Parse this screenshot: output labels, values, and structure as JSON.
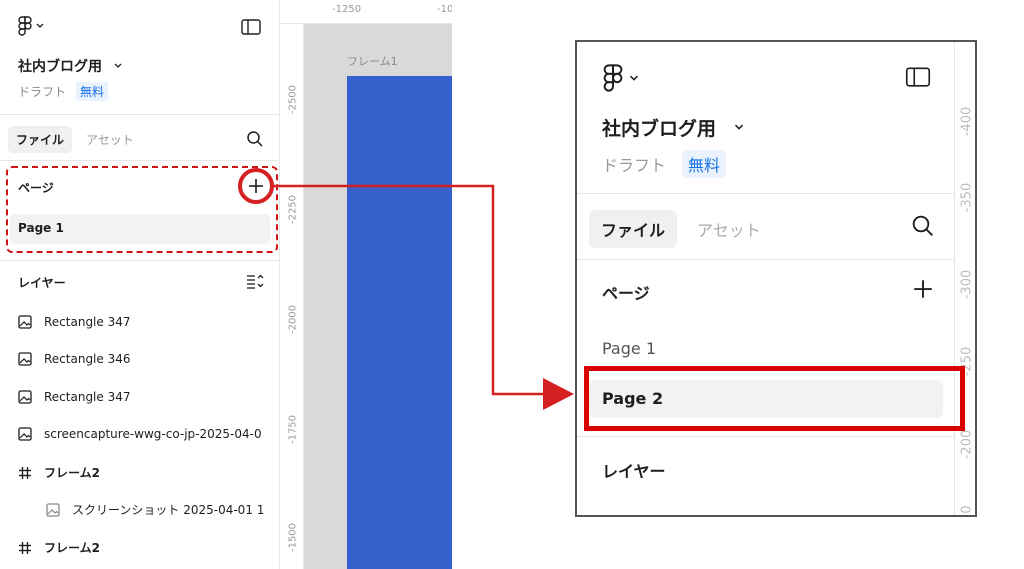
{
  "sidebar": {
    "file_title": "社内ブログ用",
    "draft_label": "ドラフト",
    "plan_badge": "無料",
    "tabs": [
      "ファイル",
      "アセット"
    ],
    "pages_header": "ページ",
    "pages": [
      "Page 1"
    ],
    "layers_header": "レイヤー",
    "layers": [
      {
        "icon": "image-icon",
        "label": "Rectangle 347"
      },
      {
        "icon": "image-icon",
        "label": "Rectangle 346"
      },
      {
        "icon": "image-icon",
        "label": "Rectangle 347"
      },
      {
        "icon": "image-icon",
        "label": "screencapture-wwg-co-jp-2025-04-0"
      },
      {
        "icon": "frame-hash-icon",
        "label": "フレーム2"
      },
      {
        "icon": "image-icon",
        "label": "スクリーンショット 2025-04-01 1"
      },
      {
        "icon": "frame-hash-icon",
        "label": "フレーム2"
      }
    ]
  },
  "canvas": {
    "ruler_top": [
      "-1250",
      "-10"
    ],
    "ruler_left": [
      "-2500",
      "-2250",
      "-2000",
      "-1750",
      "-1500"
    ],
    "frame_label": "フレーム1",
    "frame_color": "#3461cc"
  },
  "zoom": {
    "file_title": "社内ブログ用",
    "draft_label": "ドラフト",
    "plan_badge": "無料",
    "tabs": [
      "ファイル",
      "アセット"
    ],
    "pages_header": "ページ",
    "pages": [
      "Page 1",
      "Page 2"
    ],
    "layers_header": "レイヤー",
    "ruler": [
      "-400",
      "-350",
      "-300",
      "-250",
      "-200",
      "0"
    ]
  },
  "colors": {
    "highlight_red": "#d90000",
    "accent_blue": "#1a73e8"
  }
}
